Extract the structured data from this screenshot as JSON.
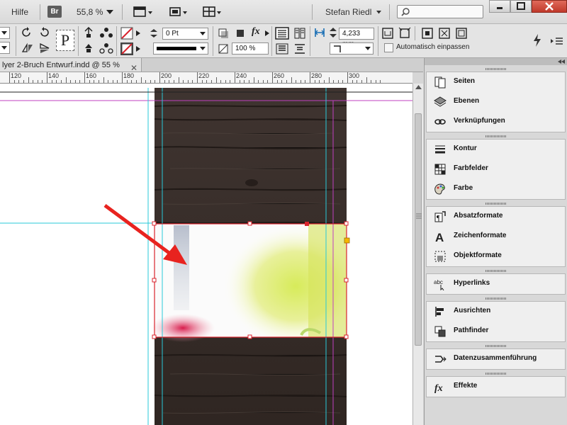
{
  "menubar": {
    "help": "Hilfe",
    "bridge": "Br",
    "zoom": "55,8 %",
    "user": "Stefan Riedl"
  },
  "control": {
    "stroke_weight": "0 Pt",
    "opacity": "100 %",
    "gap": "4,233 mm",
    "auto_fit": "Automatisch einpassen",
    "paragraph_glyph": "P",
    "fx_glyph": "fx"
  },
  "document": {
    "tab_title": "lyer 2-Bruch Entwurf.indd @ 55 %"
  },
  "ruler": {
    "labels": [
      "120",
      "140",
      "160",
      "180",
      "200",
      "220",
      "240",
      "260",
      "280",
      "300"
    ]
  },
  "panel": {
    "groups": [
      {
        "items": [
          {
            "label": "Seiten",
            "icon": "pages-icon"
          },
          {
            "label": "Ebenen",
            "icon": "layers-icon"
          },
          {
            "label": "Verknüpfungen",
            "icon": "links-icon"
          }
        ]
      },
      {
        "items": [
          {
            "label": "Kontur",
            "icon": "stroke-icon"
          },
          {
            "label": "Farbfelder",
            "icon": "swatches-icon"
          },
          {
            "label": "Farbe",
            "icon": "color-icon"
          }
        ]
      },
      {
        "items": [
          {
            "label": "Absatzformate",
            "icon": "paragraph-styles-icon"
          },
          {
            "label": "Zeichenformate",
            "icon": "character-styles-icon"
          },
          {
            "label": "Objektformate",
            "icon": "object-styles-icon"
          }
        ]
      },
      {
        "items": [
          {
            "label": "Hyperlinks",
            "icon": "hyperlinks-icon"
          }
        ]
      },
      {
        "items": [
          {
            "label": "Ausrichten",
            "icon": "align-icon"
          },
          {
            "label": "Pathfinder",
            "icon": "pathfinder-icon"
          }
        ]
      },
      {
        "items": [
          {
            "label": "Datenzusammenführung",
            "icon": "data-merge-icon"
          }
        ]
      },
      {
        "items": [
          {
            "label": "Effekte",
            "icon": "effects-icon"
          }
        ]
      }
    ],
    "hyperlink_glyph": "abc",
    "effects_glyph": "fx"
  },
  "colors": {
    "wood": "#3b302b",
    "selection": "#d9232d",
    "margin_guide": "#c040c0",
    "column_guide": "#28c8d8",
    "arrow": "#e8231f",
    "panel_bg": "#efefef"
  }
}
